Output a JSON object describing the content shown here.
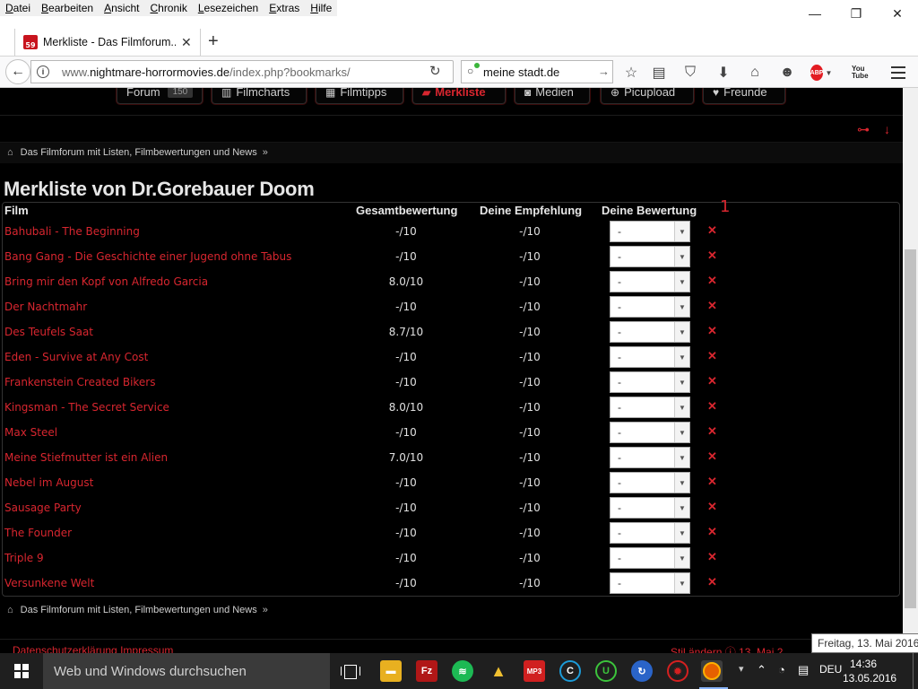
{
  "menu": [
    "Datei",
    "Bearbeiten",
    "Ansicht",
    "Chronik",
    "Lesezeichen",
    "Extras",
    "Hilfe"
  ],
  "window_controls": {
    "minimize": "—",
    "restore": "❐",
    "close": "✕"
  },
  "tab": {
    "favicon_text": "59",
    "title": "Merkliste - Das Filmforum...",
    "close": "✕"
  },
  "newtab_label": "+",
  "url": {
    "prefix": "www.",
    "domain": "nightmare-horrormovies.de",
    "path": "/index.php?bookmarks/"
  },
  "search": {
    "value": "meine stadt.de"
  },
  "toolbar_icons": [
    "bookmark-star-icon",
    "reading-list-icon",
    "pocket-icon",
    "download-icon",
    "home-icon",
    "chat-icon",
    "adblock-icon",
    "youtube-icon",
    "menu-icon"
  ],
  "adblock_label": "ABP",
  "youtube_label": "You Tube",
  "nav": [
    {
      "label": "Forum",
      "badge": "150",
      "active": false
    },
    {
      "label": "Filmcharts",
      "active": false
    },
    {
      "label": "Filmtipps",
      "active": false
    },
    {
      "label": "Merkliste",
      "active": true
    },
    {
      "label": "Medien",
      "active": false
    },
    {
      "label": "Picupload",
      "active": false
    },
    {
      "label": "Freunde",
      "active": false
    }
  ],
  "breadcrumb": {
    "text": "Das Filmforum mit Listen, Filmbewertungen und News",
    "sep": "»"
  },
  "page_title": "Merkliste von Dr.Gorebauer Doom",
  "table": {
    "headers": {
      "film": "Film",
      "gesamt": "Gesamtbewertung",
      "empfehlung": "Deine Empfehlung",
      "bewertung": "Deine Bewertung"
    },
    "rows": [
      {
        "film": "Bahubali - The Beginning",
        "gesamt": "-/10",
        "empfehlung": "-/10",
        "bewertung": "-"
      },
      {
        "film": "Bang Gang - Die Geschichte einer Jugend ohne Tabus",
        "gesamt": "-/10",
        "empfehlung": "-/10",
        "bewertung": "-"
      },
      {
        "film": "Bring mir den Kopf von Alfredo Garcia",
        "gesamt": "8.0/10",
        "empfehlung": "-/10",
        "bewertung": "-"
      },
      {
        "film": "Der Nachtmahr",
        "gesamt": "-/10",
        "empfehlung": "-/10",
        "bewertung": "-"
      },
      {
        "film": "Des Teufels Saat",
        "gesamt": "8.7/10",
        "empfehlung": "-/10",
        "bewertung": "-"
      },
      {
        "film": "Eden - Survive at Any Cost",
        "gesamt": "-/10",
        "empfehlung": "-/10",
        "bewertung": "-"
      },
      {
        "film": "Frankenstein Created Bikers",
        "gesamt": "-/10",
        "empfehlung": "-/10",
        "bewertung": "-"
      },
      {
        "film": "Kingsman - The Secret Service",
        "gesamt": "8.0/10",
        "empfehlung": "-/10",
        "bewertung": "-"
      },
      {
        "film": "Max Steel",
        "gesamt": "-/10",
        "empfehlung": "-/10",
        "bewertung": "-"
      },
      {
        "film": "Meine Stiefmutter ist ein Alien",
        "gesamt": "7.0/10",
        "empfehlung": "-/10",
        "bewertung": "-"
      },
      {
        "film": "Nebel im August",
        "gesamt": "-/10",
        "empfehlung": "-/10",
        "bewertung": "-"
      },
      {
        "film": "Sausage Party",
        "gesamt": "-/10",
        "empfehlung": "-/10",
        "bewertung": "-"
      },
      {
        "film": "The Founder",
        "gesamt": "-/10",
        "empfehlung": "-/10",
        "bewertung": "-"
      },
      {
        "film": "Triple 9",
        "gesamt": "-/10",
        "empfehlung": "-/10",
        "bewertung": "-"
      },
      {
        "film": "Versunkene Welt",
        "gesamt": "-/10",
        "empfehlung": "-/10",
        "bewertung": "-"
      }
    ],
    "delete_glyph": "✕"
  },
  "annotation": "1",
  "footer": {
    "links": "Datenschutzerklärung    Impressum",
    "right": "Stil ändern   ⓘ 13. Mai 2"
  },
  "tooltip": "Freitag, 13. Mai 2016",
  "taskbar": {
    "search_placeholder": "Web und Windows durchsuchen",
    "lang": "DEU",
    "time": "14:36",
    "date": "13.05.2016"
  },
  "colors": {
    "accent": "#d8262f",
    "page_bg": "#000000",
    "text": "#e0e0e0"
  }
}
